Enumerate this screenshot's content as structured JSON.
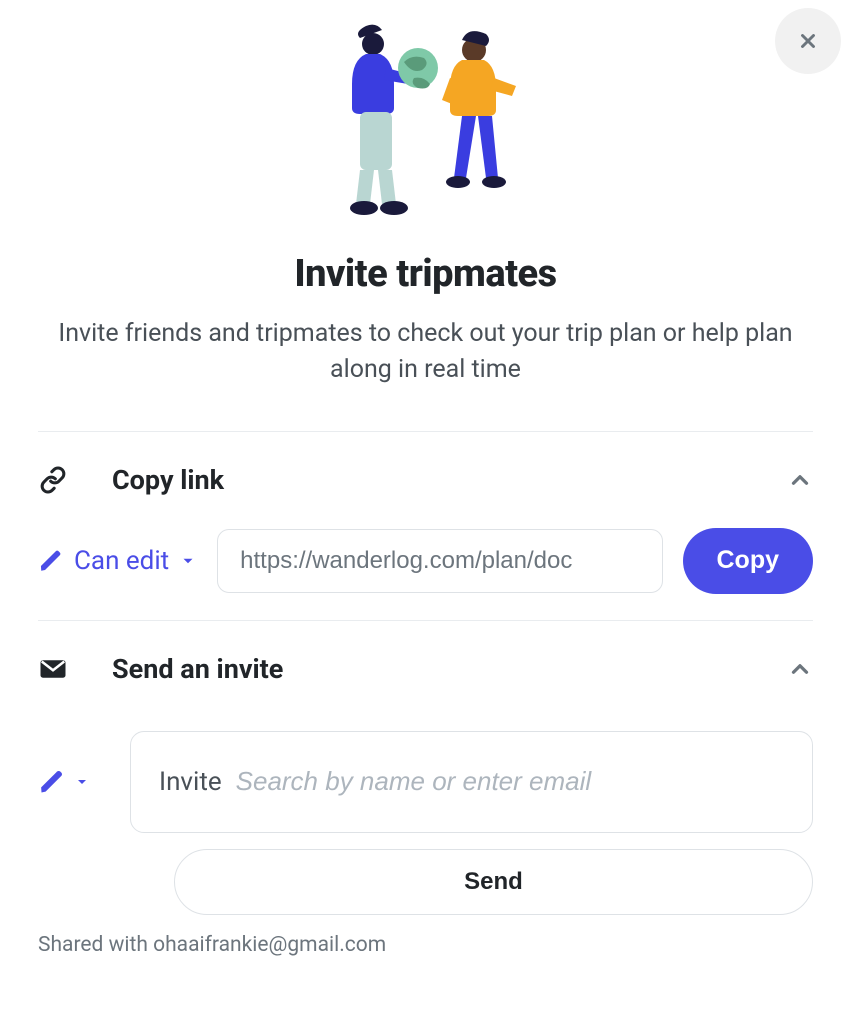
{
  "title": "Invite tripmates",
  "subtitle": "Invite friends and tripmates to check out your trip plan or help plan along in real time",
  "copyLink": {
    "heading": "Copy link",
    "permission": "Can edit",
    "url": "https://wanderlog.com/plan/doc",
    "button": "Copy"
  },
  "sendInvite": {
    "heading": "Send an invite",
    "inputPrefix": "Invite",
    "placeholder": "Search by name or enter email",
    "sendButton": "Send"
  },
  "sharedWith": "Shared with ohaaifrankie@gmail.com"
}
